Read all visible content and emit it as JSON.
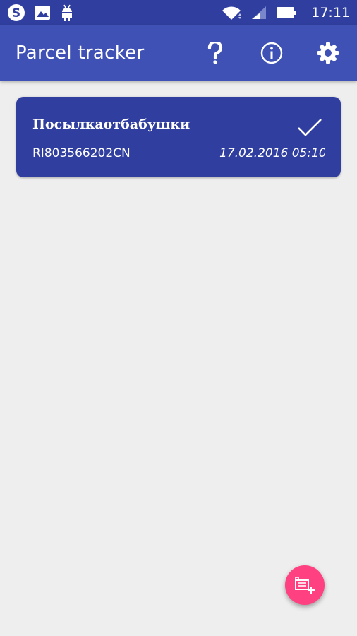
{
  "status_bar": {
    "time": "17:11",
    "left_icons": [
      "skype-icon",
      "image-icon",
      "android-icon"
    ],
    "right_icons": [
      "wifi-icon",
      "signal-icon",
      "battery-icon"
    ]
  },
  "app_bar": {
    "title": "Parcel tracker",
    "actions": [
      "help-icon",
      "info-icon",
      "settings-icon"
    ]
  },
  "parcels": [
    {
      "name": "Посылкаотбабушки",
      "tracking_code": "RI803566202CN",
      "date": "17.02.2016 05:10",
      "status_icon": "check-icon"
    }
  ],
  "fab": {
    "icon": "add-parcel-icon"
  },
  "colors": {
    "status_bar": "#303f9f",
    "app_bar": "#3f51b5",
    "card": "#303f9f",
    "fab": "#ff4081",
    "background": "#eeeeee"
  }
}
